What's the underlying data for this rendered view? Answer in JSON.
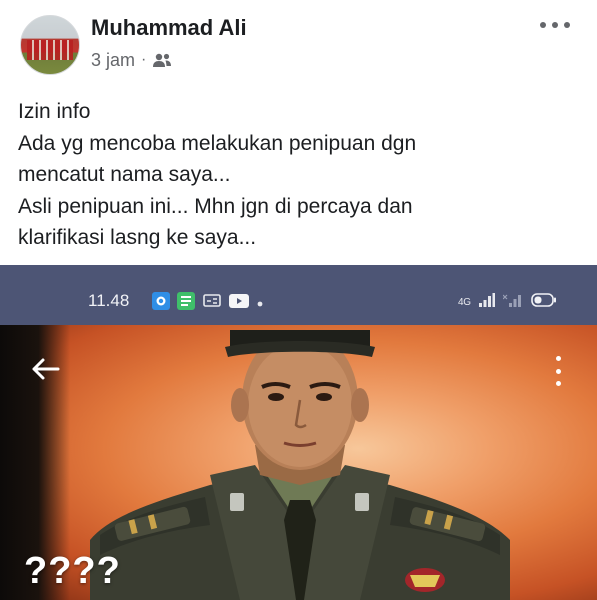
{
  "post": {
    "author_name": "Muhammad Ali",
    "timestamp": "3 jam",
    "separator": "·",
    "audience_icon": "friends-icon",
    "menu_icon": "more-horizontal-icon",
    "text_lines": [
      "Izin info",
      "Ada yg mencoba melakukan penipuan dgn",
      "mencatut nama saya...",
      "Asli penipuan ini... Mhn jgn di percaya dan",
      "klarifikasi lasng ke saya..."
    ]
  },
  "shared_screenshot": {
    "status_bar": {
      "time": "11.48",
      "notification_icons": [
        "camera-app-icon",
        "green-app-icon",
        "cast-icon",
        "youtube-icon",
        "dot-icon"
      ],
      "network_label": "4G",
      "battery_icon": "battery-icon"
    },
    "back_icon": "arrow-left-icon",
    "menu_icon": "more-vertical-icon",
    "caption": "????"
  },
  "colors": {
    "author_text": "#1c1e21",
    "meta_text": "#65676b",
    "status_bar_bg": "#4d5575",
    "photo_bg": "#e27a3e",
    "uniform": "#3b3f33"
  }
}
